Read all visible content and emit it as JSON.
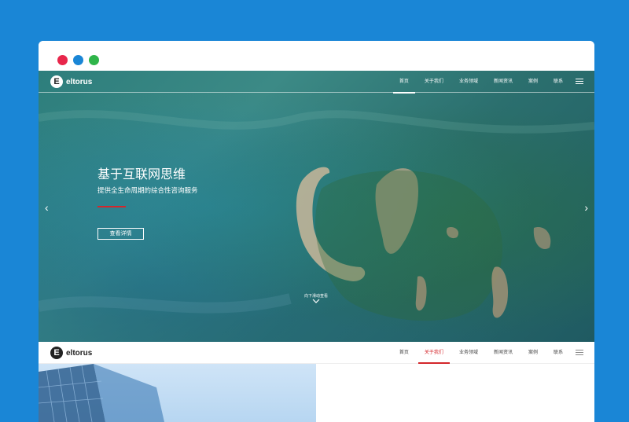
{
  "window": {
    "traffic_lights": [
      "#e8264b",
      "#1a86d6",
      "#2fb54a"
    ]
  },
  "brand": {
    "logo_letter": "E",
    "name": "eltorus"
  },
  "nav": {
    "items": [
      {
        "label": "首页"
      },
      {
        "label": "关于我们"
      },
      {
        "label": "业务领域"
      },
      {
        "label": "新闻资讯"
      },
      {
        "label": "案例"
      },
      {
        "label": "联系"
      }
    ],
    "active_hero": 0,
    "active_secondary": 1
  },
  "hero": {
    "title": "基于互联网思维",
    "subtitle": "提供全生命周期的综合性咨询服务",
    "button_label": "查看详情",
    "prev_arrow": "‹",
    "next_arrow": "›",
    "scroll_hint": "向下滑动查看",
    "accent_color": "#d4262b"
  }
}
